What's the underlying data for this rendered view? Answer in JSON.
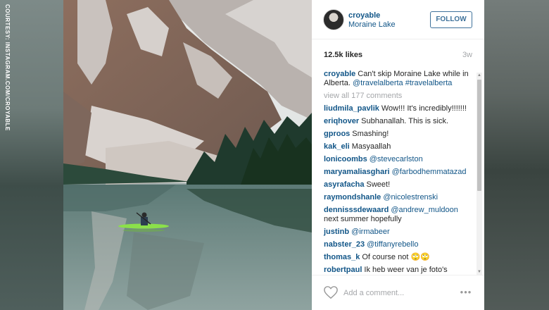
{
  "credit": {
    "text": "COURTESY: INSTAGRAM.COM/CROYABLE"
  },
  "post": {
    "username": "croyable",
    "location": "Moraine Lake",
    "follow_label": "FOLLOW",
    "likes": "12.5k likes",
    "age": "3w",
    "caption": {
      "username": "croyable",
      "text": "Can't skip Moraine Lake while in Alberta. ",
      "tags": "@travelalberta #travelalberta"
    },
    "view_all": "view all 177 comments",
    "comments": [
      {
        "user": "liudmila_pavlik",
        "text": "Wow!!! It's incredibly!!!!!!!",
        "mention": ""
      },
      {
        "user": "eriqhover",
        "text": "Subhanallah. This is sick.",
        "mention": ""
      },
      {
        "user": "gproos",
        "text": "Smashing!",
        "mention": ""
      },
      {
        "user": "kak_eli",
        "text": "Masyaallah",
        "mention": ""
      },
      {
        "user": "lonicoombs",
        "text": "",
        "mention": "@stevecarlston"
      },
      {
        "user": "maryamaliasghari",
        "text": "",
        "mention": "@farbodhemmatazad"
      },
      {
        "user": "asyrafacha",
        "text": "Sweet!",
        "mention": ""
      },
      {
        "user": "raymondshanle",
        "text": "",
        "mention": "@nicolestrenski"
      },
      {
        "user": "dennisssdewaard",
        "text": " next summer hopefully",
        "mention": "@andrew_muldoon"
      },
      {
        "user": "justinb",
        "text": "",
        "mention": "@irmabeer"
      },
      {
        "user": "nabster_23",
        "text": "",
        "mention": "@tiffanyrebello"
      },
      {
        "user": "thomas_k",
        "text": "Of course not 🙄🙄",
        "mention": ""
      },
      {
        "user": "robertpaul",
        "text": "Ik heb weer van je foto's",
        "mention": ""
      }
    ],
    "add_comment_placeholder": "Add a comment...",
    "more_label": "•••"
  },
  "colors": {
    "link": "#125688",
    "follow_border": "#3f729b",
    "muted": "#a5a7aa"
  }
}
